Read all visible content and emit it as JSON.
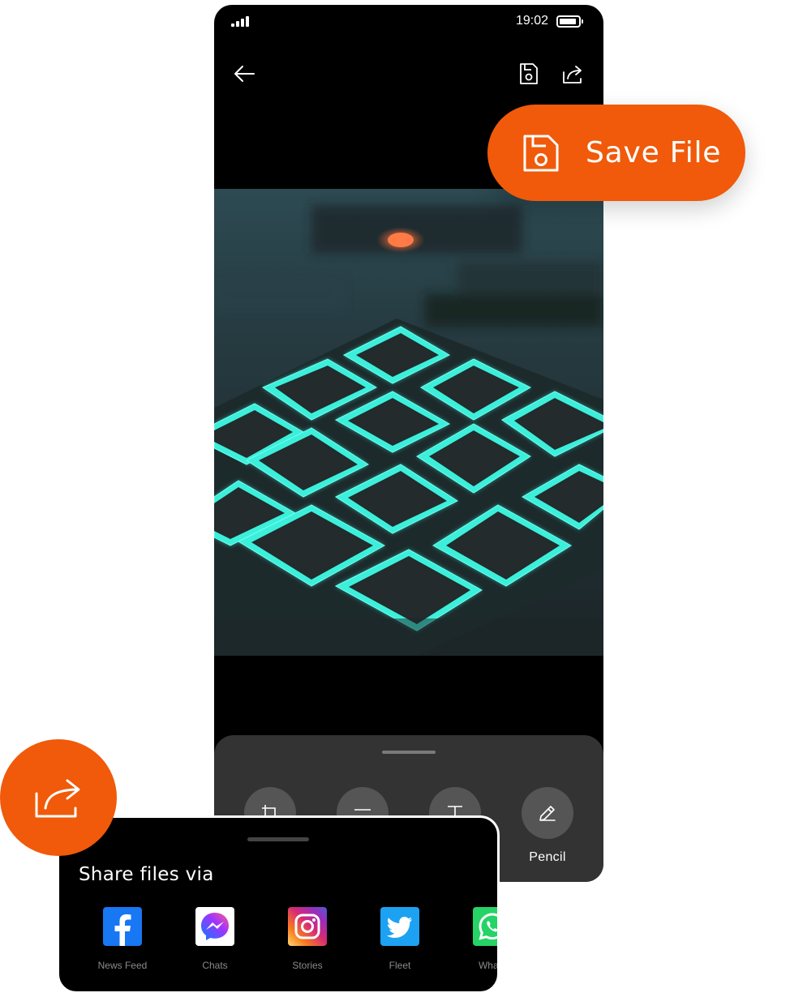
{
  "status_bar": {
    "time": "19:02"
  },
  "editor": {
    "tools": [
      {
        "name": "crop"
      },
      {
        "name": "filter"
      },
      {
        "name": "text"
      },
      {
        "name": "pencil",
        "label": "Pencil"
      }
    ]
  },
  "save_callout": {
    "label": "Save File",
    "color": "#f05a0a"
  },
  "share_sheet": {
    "title": "Share files via",
    "apps": [
      {
        "label": "News Feed",
        "icon": "facebook-icon",
        "color": "#1877f2"
      },
      {
        "label": "Chats",
        "icon": "messenger-icon",
        "color": "#ffffff"
      },
      {
        "label": "Stories",
        "icon": "instagram-icon",
        "color": "#d62976"
      },
      {
        "label": "Fleet",
        "icon": "twitter-icon",
        "color": "#1da1f2"
      },
      {
        "label": "Whats",
        "icon": "whatsapp-icon",
        "color": "#25d366"
      }
    ]
  },
  "icons": {
    "back": "arrow-left-icon",
    "save": "floppy-disk-icon",
    "share": "share-arrow-icon"
  }
}
